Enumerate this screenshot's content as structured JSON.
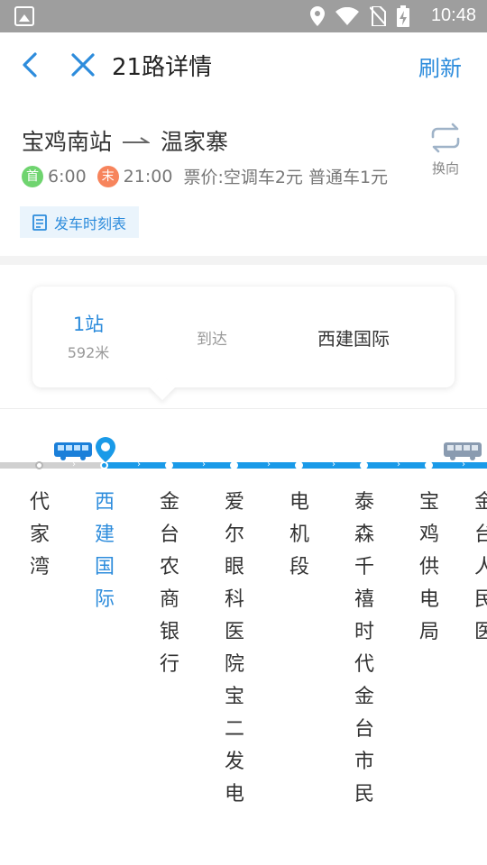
{
  "status_bar": {
    "time": "10:48"
  },
  "header": {
    "title": "21路详情",
    "refresh_label": "刷新"
  },
  "route": {
    "from": "宝鸡南站",
    "to": "温家寨",
    "swap_label": "换向",
    "first_badge": "首",
    "first_time": "6:00",
    "last_badge": "末",
    "last_time": "21:00",
    "fare": "票价:空调车2元 普通车1元",
    "schedule_label": "发车时刻表"
  },
  "arrival": {
    "stops": "1站",
    "distance": "592米",
    "arrive_label": "到达",
    "destination": "西建国际"
  },
  "stations": [
    {
      "name": "代家湾"
    },
    {
      "name": "西建国际"
    },
    {
      "name": "金台农商银行"
    },
    {
      "name": "爱尔眼科医院宝二发电"
    },
    {
      "name": "电机段"
    },
    {
      "name": "泰森千禧时代金台市民"
    },
    {
      "name": "宝鸡供电局"
    },
    {
      "name": "金台人民医"
    }
  ],
  "colors": {
    "accent": "#2d8cdc",
    "track_active": "#1a9ae8",
    "track_passed": "#d0d0d0"
  }
}
